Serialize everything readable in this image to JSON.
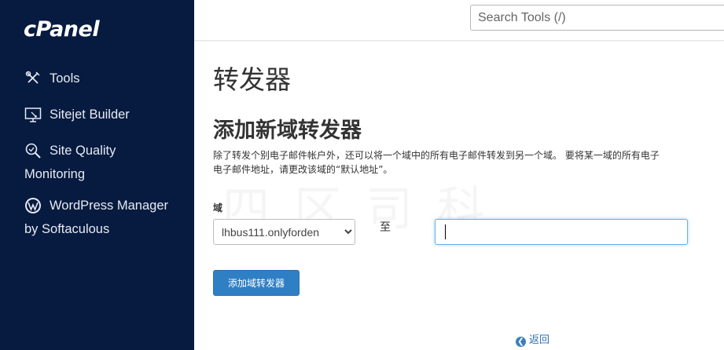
{
  "app": {
    "logo_text": "cPanel"
  },
  "sidebar": {
    "items": [
      {
        "label": "Tools",
        "icon": "tools-icon"
      },
      {
        "label": "Sitejet Builder",
        "icon": "sitejet-monitor-icon"
      },
      {
        "label": "Site Quality",
        "label2": "Monitoring",
        "icon": "site-quality-search-icon"
      },
      {
        "label": "WordPress Manager",
        "label2": "by Softaculous",
        "icon": "wordpress-icon"
      }
    ]
  },
  "header": {
    "search_placeholder": "Search Tools (/)"
  },
  "main": {
    "page_title": "转发器",
    "section_title": "添加新域转发器",
    "description_line1": "除了转发个别电子邮件帐户外，还可以将一个域中的所有电子邮件转发到另一个域。 要将某一域的所有电子",
    "description_line2": "电子邮件地址，请更改该域的“默认地址”。",
    "watermark": "四 区 司 科",
    "domain_label": "域",
    "domain_selected": "lhbus111.onlyforden",
    "to_label": "至",
    "target_value": "",
    "add_button_label": "添加域转发器",
    "back_link_label": "返回"
  },
  "colors": {
    "sidebar_bg": "#071a3f",
    "button_bg": "#2f7fc4",
    "link": "#2c6fb6",
    "focus_border": "#66afe9"
  }
}
